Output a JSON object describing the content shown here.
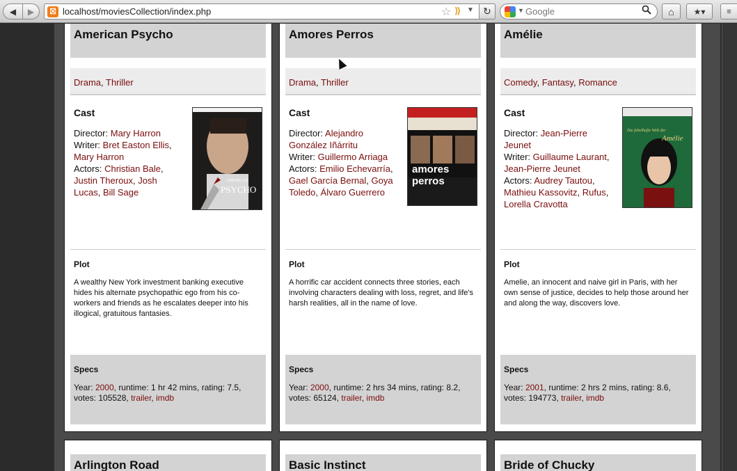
{
  "browser": {
    "url": "localhost/moviesCollection/index.php",
    "search_placeholder": "Google",
    "favicon_glyph": "⛝",
    "back_icon": "◀",
    "forward_icon": "▶",
    "reload_icon": "↻",
    "home_icon": "⌂",
    "bookmarks_icon": "★▾",
    "extension_icon": "≡",
    "star_icon": "☆",
    "rss_icon": "⟫",
    "dropdown_icon": "▼",
    "search_icon": "🔍"
  },
  "section_labels": {
    "cast": "Cast",
    "plot": "Plot",
    "specs": "Specs",
    "director": "Director:",
    "writer": "Writer:",
    "actors": "Actors:",
    "year": "Year:",
    "runtime": "runtime:",
    "rating": "rating:",
    "votes": "votes:",
    "trailer": "trailer",
    "imdb": "imdb"
  },
  "movies": [
    {
      "title": "American Psycho",
      "genres": [
        "Drama",
        "Thriller"
      ],
      "directors": [
        "Mary Harron"
      ],
      "writers": [
        "Bret Easton Ellis",
        "Mary Harron"
      ],
      "actors": [
        "Christian Bale",
        "Justin Theroux",
        "Josh Lucas",
        "Bill Sage"
      ],
      "plot": "A wealthy New York investment banking executive hides his alternate psychopathic ego from his co-workers and friends as he escalates deeper into his illogical, gratuitous fantasies.",
      "year": "2000",
      "runtime": "1 hr 42 mins",
      "rating": "7.5",
      "votes": "105528",
      "poster_text": "PSYCHO",
      "poster_top_text": "AMERICAN"
    },
    {
      "title": "Amores Perros",
      "genres": [
        "Drama",
        "Thriller"
      ],
      "directors": [
        "Alejandro González Iñárritu"
      ],
      "writers": [
        "Guillermo Arriaga"
      ],
      "actors": [
        "Emilio Echevarría",
        "Gael García Bernal",
        "Goya Toledo",
        "Álvaro Guerrero"
      ],
      "plot": "A horrific car accident connects three stories, each involving characters dealing with loss, regret, and life's harsh realities, all in the name of love.",
      "year": "2000",
      "runtime": "2 hrs 34 mins",
      "rating": "8.2",
      "votes": "65124",
      "poster_text": "amores perros"
    },
    {
      "title": "Amélie",
      "genres": [
        "Comedy",
        "Fantasy",
        "Romance"
      ],
      "directors": [
        "Jean-Pierre Jeunet"
      ],
      "writers": [
        "Guillaume Laurant",
        "Jean-Pierre Jeunet"
      ],
      "actors": [
        "Audrey Tautou",
        "Mathieu Kassovitz",
        "Rufus",
        "Lorella Cravotta"
      ],
      "plot": "Amelie, an innocent and naive girl in Paris, with her own sense of justice, decides to help those around her and along the way, discovers love.",
      "year": "2001",
      "runtime": "2 hrs 2 mins",
      "rating": "8.6",
      "votes": "194773",
      "poster_text": "Amélie",
      "poster_top_text": "Die fabelhafte Welt der"
    }
  ],
  "next_row_titles": [
    "Arlington Road",
    "Basic Instinct",
    "Bride of Chucky"
  ]
}
